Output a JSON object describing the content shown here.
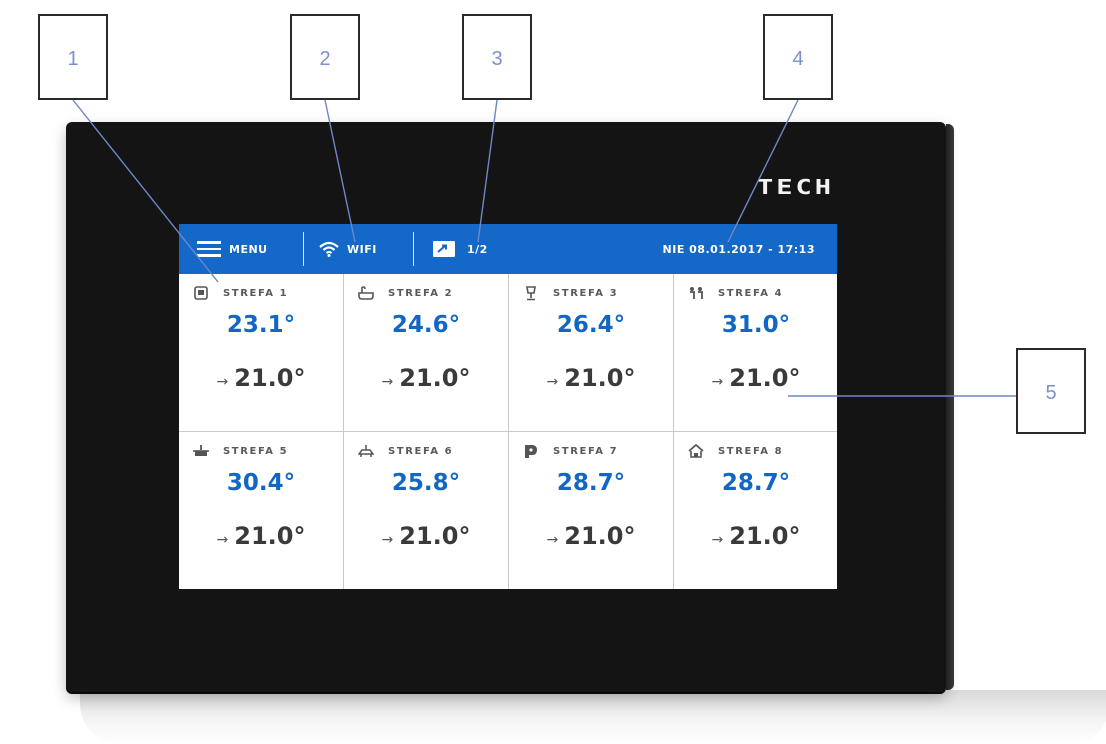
{
  "device": {
    "brand": "TECH"
  },
  "topbar": {
    "menu_label": "MENU",
    "wifi_label": "WIFI",
    "page_indicator": "1/2",
    "datetime": "NIE 08.01.2017 - 17:13"
  },
  "zones": [
    {
      "name": "STREFA 1",
      "icon": "room-icon",
      "temp": "23.1°",
      "set": "21.0°"
    },
    {
      "name": "STREFA 2",
      "icon": "bath-icon",
      "temp": "24.6°",
      "set": "21.0°"
    },
    {
      "name": "STREFA 3",
      "icon": "lamp-icon",
      "temp": "26.4°",
      "set": "21.0°"
    },
    {
      "name": "STREFA 4",
      "icon": "children-icon",
      "temp": "31.0°",
      "set": "21.0°"
    },
    {
      "name": "STREFA 5",
      "icon": "kitchen-icon",
      "temp": "30.4°",
      "set": "21.0°"
    },
    {
      "name": "STREFA 6",
      "icon": "table-icon",
      "temp": "25.8°",
      "set": "21.0°"
    },
    {
      "name": "STREFA 7",
      "icon": "door-icon",
      "temp": "28.7°",
      "set": "21.0°"
    },
    {
      "name": "STREFA 8",
      "icon": "house-icon",
      "temp": "28.7°",
      "set": "21.0°"
    }
  ],
  "callouts": [
    "1",
    "2",
    "3",
    "4",
    "5"
  ]
}
